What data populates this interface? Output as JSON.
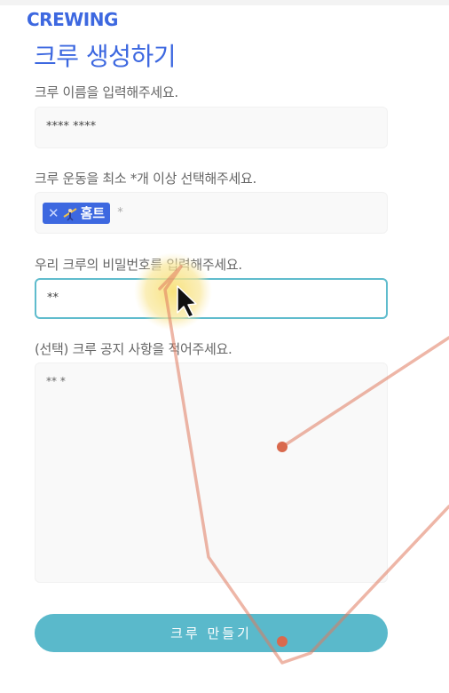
{
  "app": {
    "logo": "CREWING"
  },
  "page": {
    "title": "크루 생성하기"
  },
  "form": {
    "name_label": "크루 이름을 입력해주세요.",
    "name_value": "**** ****",
    "sports_label": "크루 운동을 최소 *개 이상 선택해주세요.",
    "sports_tags": [
      {
        "label": "홈트",
        "remove": "✕",
        "icon": "fitness-icon"
      }
    ],
    "sports_placeholder": "*",
    "password_label": "우리 크루의 비밀번호를 입력해주세요.",
    "password_value": "**",
    "notice_label": "(선택) 크루 공지 사항을 적어주세요.",
    "notice_value": "** *",
    "submit_label": "크루 만들기"
  },
  "colors": {
    "brand": "#3d68e0",
    "accent": "#5ab9cb",
    "focus_border": "#5fbccd",
    "annotation": "#e07a5f"
  }
}
